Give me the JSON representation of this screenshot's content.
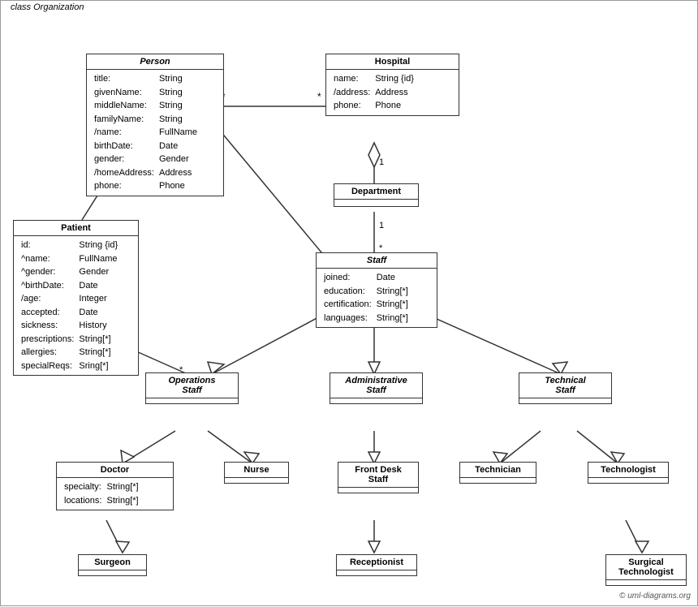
{
  "diagram_title": "class Organization",
  "classes": {
    "person": {
      "name": "Person",
      "italic": true,
      "attributes": [
        [
          "title:",
          "String"
        ],
        [
          "givenName:",
          "String"
        ],
        [
          "middleName:",
          "String"
        ],
        [
          "familyName:",
          "String"
        ],
        [
          "/name:",
          "FullName"
        ],
        [
          "birthDate:",
          "Date"
        ],
        [
          "gender:",
          "Gender"
        ],
        [
          "/homeAddress:",
          "Address"
        ],
        [
          "phone:",
          "Phone"
        ]
      ]
    },
    "hospital": {
      "name": "Hospital",
      "italic": false,
      "attributes": [
        [
          "name:",
          "String {id}"
        ],
        [
          "/address:",
          "Address"
        ],
        [
          "phone:",
          "Phone"
        ]
      ]
    },
    "department": {
      "name": "Department",
      "italic": false,
      "attributes": []
    },
    "staff": {
      "name": "Staff",
      "italic": true,
      "attributes": [
        [
          "joined:",
          "Date"
        ],
        [
          "education:",
          "String[*]"
        ],
        [
          "certification:",
          "String[*]"
        ],
        [
          "languages:",
          "String[*]"
        ]
      ]
    },
    "patient": {
      "name": "Patient",
      "italic": false,
      "attributes": [
        [
          "id:",
          "String {id}"
        ],
        [
          "^name:",
          "FullName"
        ],
        [
          "^gender:",
          "Gender"
        ],
        [
          "^birthDate:",
          "Date"
        ],
        [
          "/age:",
          "Integer"
        ],
        [
          "accepted:",
          "Date"
        ],
        [
          "sickness:",
          "History"
        ],
        [
          "prescriptions:",
          "String[*]"
        ],
        [
          "allergies:",
          "String[*]"
        ],
        [
          "specialReqs:",
          "Sring[*]"
        ]
      ]
    },
    "operations_staff": {
      "name": "Operations Staff",
      "italic": true
    },
    "admin_staff": {
      "name": "Administrative Staff",
      "italic": true
    },
    "technical_staff": {
      "name": "Technical Staff",
      "italic": true
    },
    "doctor": {
      "name": "Doctor",
      "attributes": [
        [
          "specialty:",
          "String[*]"
        ],
        [
          "locations:",
          "String[*]"
        ]
      ]
    },
    "nurse": {
      "name": "Nurse"
    },
    "front_desk": {
      "name": "Front Desk Staff"
    },
    "technician": {
      "name": "Technician"
    },
    "technologist": {
      "name": "Technologist"
    },
    "surgeon": {
      "name": "Surgeon"
    },
    "receptionist": {
      "name": "Receptionist"
    },
    "surgical_technologist": {
      "name": "Surgical Technologist"
    }
  },
  "copyright": "© uml-diagrams.org"
}
